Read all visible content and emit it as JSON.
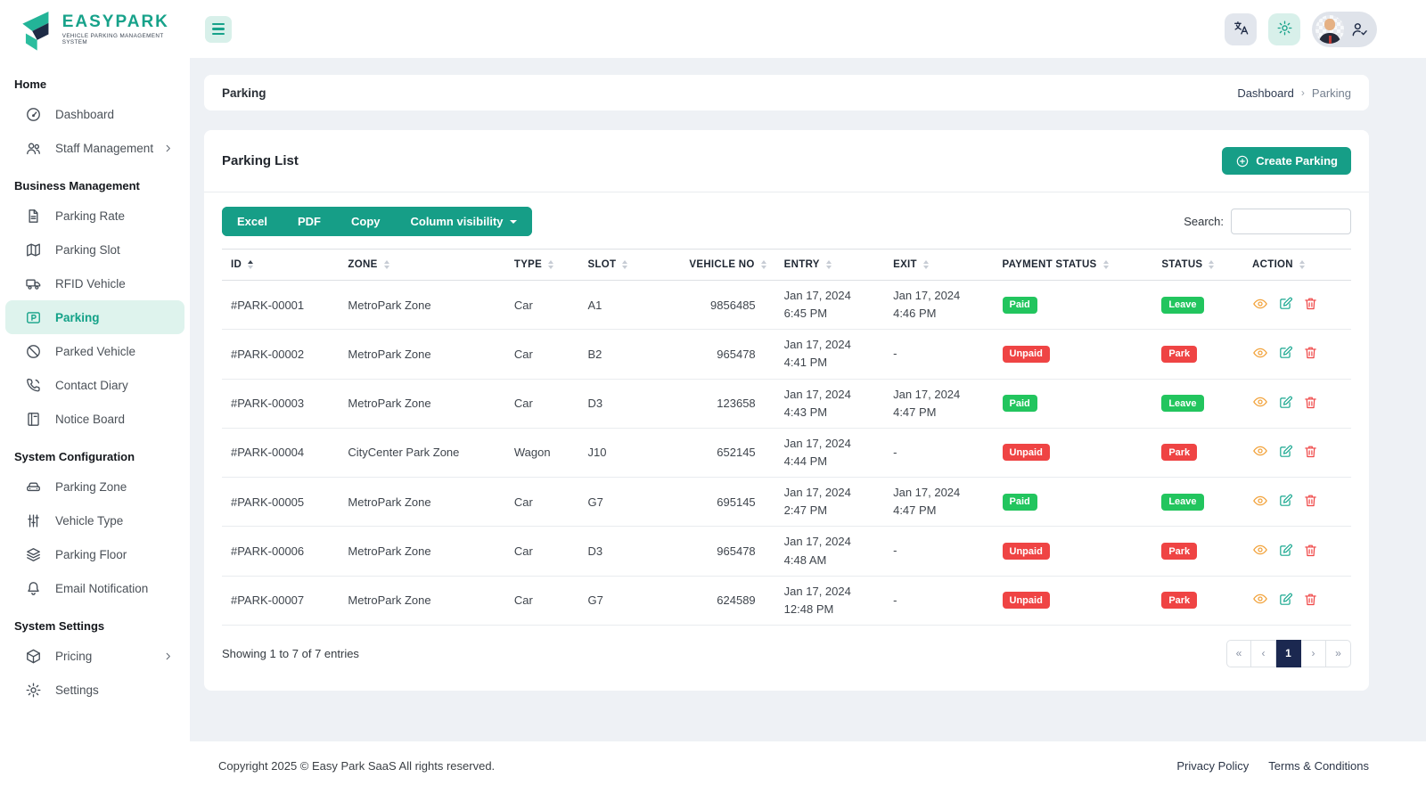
{
  "brand": {
    "name": "EASYPARK",
    "tagline": "VEHICLE PARKING MANAGEMENT SYSTEM"
  },
  "sidebar": {
    "sections": [
      {
        "title": "Home",
        "items": [
          {
            "label": "Dashboard",
            "icon": "speedometer-icon"
          },
          {
            "label": "Staff Management",
            "icon": "users-icon",
            "chevron": true
          }
        ]
      },
      {
        "title": "Business Management",
        "items": [
          {
            "label": "Parking Rate",
            "icon": "document-icon"
          },
          {
            "label": "Parking Slot",
            "icon": "map-icon"
          },
          {
            "label": "RFID Vehicle",
            "icon": "truck-icon"
          },
          {
            "label": "Parking",
            "icon": "parking-card-icon",
            "active": true
          },
          {
            "label": "Parked Vehicle",
            "icon": "ban-icon"
          },
          {
            "label": "Contact Diary",
            "icon": "phone-icon"
          },
          {
            "label": "Notice Board",
            "icon": "notice-icon"
          }
        ]
      },
      {
        "title": "System Configuration",
        "items": [
          {
            "label": "Parking Zone",
            "icon": "car-icon"
          },
          {
            "label": "Vehicle Type",
            "icon": "sliders-icon"
          },
          {
            "label": "Parking Floor",
            "icon": "layers-icon"
          },
          {
            "label": "Email Notification",
            "icon": "bell-icon"
          }
        ]
      },
      {
        "title": "System Settings",
        "items": [
          {
            "label": "Pricing",
            "icon": "box-icon",
            "chevron": true
          },
          {
            "label": "Settings",
            "icon": "gear-icon"
          }
        ]
      }
    ]
  },
  "breadcrumb": {
    "page_title": "Parking",
    "path": [
      "Dashboard",
      "Parking"
    ]
  },
  "card": {
    "title": "Parking List",
    "create_button": "Create Parking",
    "export_buttons": [
      "Excel",
      "PDF",
      "Copy"
    ],
    "column_visibility": "Column visibility",
    "search_label": "Search:"
  },
  "table": {
    "columns": [
      "ID",
      "ZONE",
      "TYPE",
      "SLOT",
      "VEHICLE NO",
      "ENTRY",
      "EXIT",
      "PAYMENT STATUS",
      "STATUS",
      "ACTION"
    ],
    "rows": [
      {
        "id": "#PARK-00001",
        "zone": "MetroPark Zone",
        "type": "Car",
        "slot": "A1",
        "vehicle_no": "9856485",
        "entry_date": "Jan 17, 2024",
        "entry_time": "6:45 PM",
        "exit_date": "Jan 17, 2024",
        "exit_time": "4:46 PM",
        "payment": "Paid",
        "status": "Leave"
      },
      {
        "id": "#PARK-00002",
        "zone": "MetroPark Zone",
        "type": "Car",
        "slot": "B2",
        "vehicle_no": "965478",
        "entry_date": "Jan 17, 2024",
        "entry_time": "4:41 PM",
        "exit_date": "-",
        "exit_time": "",
        "payment": "Unpaid",
        "status": "Park"
      },
      {
        "id": "#PARK-00003",
        "zone": "MetroPark Zone",
        "type": "Car",
        "slot": "D3",
        "vehicle_no": "123658",
        "entry_date": "Jan 17, 2024",
        "entry_time": "4:43 PM",
        "exit_date": "Jan 17, 2024",
        "exit_time": "4:47 PM",
        "payment": "Paid",
        "status": "Leave"
      },
      {
        "id": "#PARK-00004",
        "zone": "CityCenter Park Zone",
        "type": "Wagon",
        "slot": "J10",
        "vehicle_no": "652145",
        "entry_date": "Jan 17, 2024",
        "entry_time": "4:44 PM",
        "exit_date": "-",
        "exit_time": "",
        "payment": "Unpaid",
        "status": "Park"
      },
      {
        "id": "#PARK-00005",
        "zone": "MetroPark Zone",
        "type": "Car",
        "slot": "G7",
        "vehicle_no": "695145",
        "entry_date": "Jan 17, 2024",
        "entry_time": "2:47 PM",
        "exit_date": "Jan 17, 2024",
        "exit_time": "4:47 PM",
        "payment": "Paid",
        "status": "Leave"
      },
      {
        "id": "#PARK-00006",
        "zone": "MetroPark Zone",
        "type": "Car",
        "slot": "D3",
        "vehicle_no": "965478",
        "entry_date": "Jan 17, 2024",
        "entry_time": "4:48 AM",
        "exit_date": "-",
        "exit_time": "",
        "payment": "Unpaid",
        "status": "Park"
      },
      {
        "id": "#PARK-00007",
        "zone": "MetroPark Zone",
        "type": "Car",
        "slot": "G7",
        "vehicle_no": "624589",
        "entry_date": "Jan 17, 2024",
        "entry_time": "12:48 PM",
        "exit_date": "-",
        "exit_time": "",
        "payment": "Unpaid",
        "status": "Park"
      }
    ],
    "summary": "Showing 1 to 7 of 7 entries",
    "pagination": [
      "«",
      "‹",
      "1",
      "›",
      "»"
    ],
    "active_page": "1"
  },
  "footer": {
    "copyright": "Copyright 2025 © Easy Park SaaS All rights reserved.",
    "links": [
      "Privacy Policy",
      "Terms & Conditions"
    ]
  },
  "colors": {
    "primary": "#169e87",
    "badge_styles": {
      "Paid": "#22c55e",
      "Unpaid": "#ef4444",
      "Leave": "#22c55e",
      "Park": "#ef4444"
    },
    "navy": "#1b2850"
  }
}
